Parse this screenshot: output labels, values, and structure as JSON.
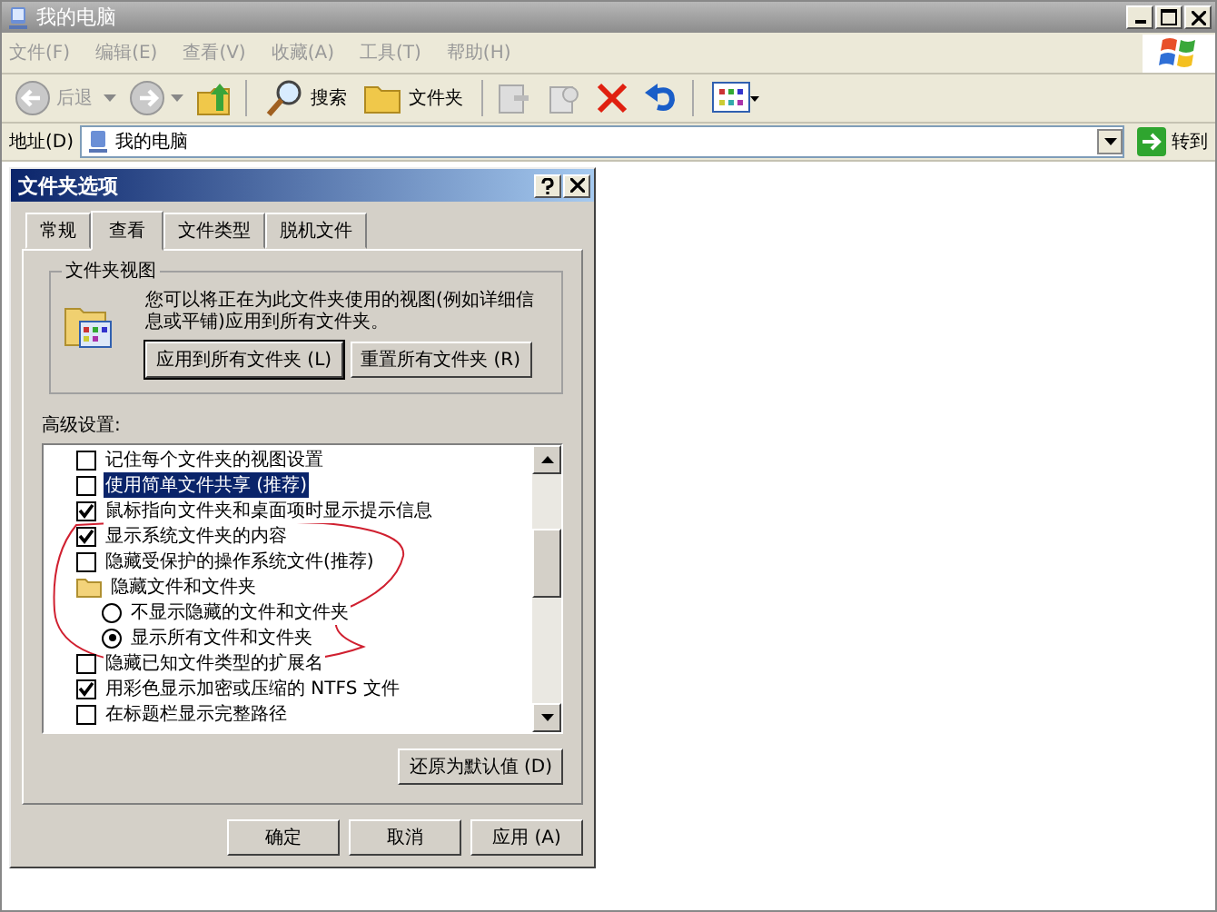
{
  "window": {
    "title": "我的电脑"
  },
  "menu": [
    "文件(F)",
    "编辑(E)",
    "查看(V)",
    "收藏(A)",
    "工具(T)",
    "帮助(H)"
  ],
  "toolbar": {
    "back": "后退",
    "search": "搜索",
    "folders": "文件夹"
  },
  "address": {
    "label": "地址(D)",
    "value": "我的电脑",
    "go": "转到"
  },
  "dialog": {
    "title": "文件夹选项",
    "tabs": [
      {
        "label": "常规",
        "selected": false
      },
      {
        "label": "查看",
        "selected": true
      },
      {
        "label": "文件类型",
        "selected": false
      },
      {
        "label": "脱机文件",
        "selected": false
      }
    ],
    "folder_views": {
      "title": "文件夹视图",
      "text": "您可以将正在为此文件夹使用的视图(例如详细信息或平铺)应用到所有文件夹。",
      "buttons": [
        "应用到所有文件夹 (L)",
        "重置所有文件夹 (R)"
      ]
    },
    "advanced_label": "高级设置:",
    "settings": [
      {
        "kind": "checkbox",
        "label": "记住每个文件夹的视图设置",
        "checked": false,
        "highlighted": false
      },
      {
        "kind": "checkbox",
        "label": "使用简单文件共享 (推荐)",
        "checked": false,
        "highlighted": true
      },
      {
        "kind": "checkbox",
        "label": "鼠标指向文件夹和桌面项时显示提示信息",
        "checked": true,
        "highlighted": false
      },
      {
        "kind": "checkbox",
        "label": "显示系统文件夹的内容",
        "checked": true,
        "highlighted": false
      },
      {
        "kind": "checkbox",
        "label": "隐藏受保护的操作系统文件(推荐)",
        "checked": false,
        "highlighted": false
      },
      {
        "kind": "folder",
        "label": "隐藏文件和文件夹",
        "highlighted": false,
        "children": [
          {
            "kind": "radio",
            "label": "不显示隐藏的文件和文件夹",
            "selected": false,
            "highlighted": false
          },
          {
            "kind": "radio",
            "label": "显示所有文件和文件夹",
            "selected": true,
            "highlighted": false
          }
        ]
      },
      {
        "kind": "checkbox",
        "label": "隐藏已知文件类型的扩展名",
        "checked": false,
        "highlighted": false
      },
      {
        "kind": "checkbox",
        "label": "用彩色显示加密或压缩的 NTFS 文件",
        "checked": true,
        "highlighted": false
      },
      {
        "kind": "checkbox",
        "label": "在标题栏显示完整路径",
        "checked": false,
        "highlighted": false
      }
    ],
    "restore_button": "还原为默认值 (D)",
    "buttons": [
      "确定",
      "取消",
      "应用 (A)"
    ]
  }
}
